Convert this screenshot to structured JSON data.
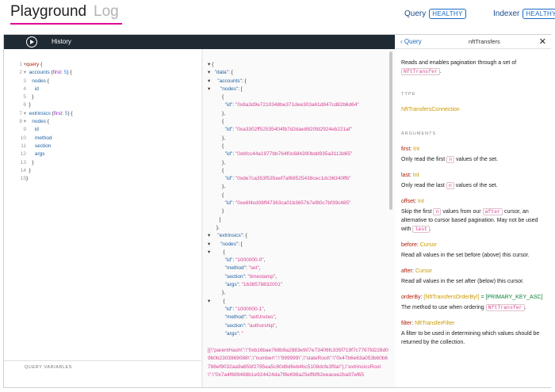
{
  "tabs": {
    "playground": "Playground",
    "log": "Log"
  },
  "status": {
    "query_label": "Query",
    "query_badge": "HEALTHY",
    "indexer_label": "Indexer",
    "indexer_badge": "HEALTHY"
  },
  "toolbar": {
    "history_label": "History"
  },
  "query_vars_label": "QUERY VARIABLES",
  "line_numbers": [
    "1 ▾",
    "2 ▾",
    "3",
    "4",
    "5",
    "6",
    "7 ▾",
    "8 ▾",
    "9",
    "10",
    "11",
    "12",
    "13",
    "14",
    "15"
  ],
  "result_wrap_text": "[{\\\"parentHash\\\":\\\"0xb16bae768b9a2883e907e73406fc335f719f7c7767fd228d09b0b2303969088\\\",\\\"number\\\":\\\"999999\\\",\\\"stateRoot\\\":\\\"0x47b6e63a053b60b6788ef9032aa9a65bf2785ea5c80d8d6eb4bc5108dcfe3f9a\\\"},\\\"extrinsicsRoot\\\":\\\"0x7a4f689488b1e924424da7f8e698a25effbf92eeacee2ba97ef65",
  "docs": {
    "back_label": "Query",
    "title": "nftTransfers",
    "close": "✕",
    "description_prefix": "Reads and enables pagination through a set of",
    "description_tag": "NftTransfer",
    "description_suffix": ".",
    "type_label": "TYPE",
    "type_value": "NftTransfersConnection",
    "arguments_label": "ARGUMENTS",
    "args": [
      {
        "name": "first",
        "type": "Int",
        "desc_pre": "Only read the first",
        "desc_tag": "n",
        "desc_post": "values of the set."
      },
      {
        "name": "last",
        "type": "Int",
        "desc_pre": "Only read the last",
        "desc_tag": "n",
        "desc_post": "values of the set."
      },
      {
        "name": "offset",
        "type": "Int",
        "desc_pre": "Skip the first",
        "desc_tag": "n",
        "desc_mid": "values from our",
        "desc_tag2": "after",
        "desc_post": "cursor, an alternative to cursor based pagination. May not be used with",
        "desc_tag3": "last",
        "desc_end": "."
      },
      {
        "name": "before",
        "type": "Cursor",
        "desc": "Read all values in the set before (above) this cursor."
      },
      {
        "name": "after",
        "type": "Cursor",
        "desc": "Read all values in the set after (below) this cursor."
      },
      {
        "name": "orderBy",
        "type": "[NftTransfersOrderBy!]",
        "default": "= [PRIMARY_KEY_ASC]",
        "desc_pre": "The method to use when ordering",
        "desc_tag": "NftTransfer",
        "desc_post": "."
      },
      {
        "name": "filter",
        "type": "NftTransferFilter",
        "desc": "A filter to be used in determining which values should be returned by the collection."
      }
    ]
  }
}
